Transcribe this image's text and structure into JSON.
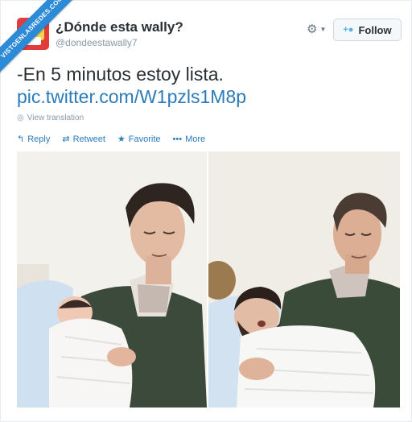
{
  "watermark": {
    "text": "VISTOENLASREDES.COM"
  },
  "profile": {
    "name": "¿Dónde esta wally?",
    "handle": "@dondeestawally7"
  },
  "header": {
    "follow_label": "Follow",
    "gear_icon": "gear-icon"
  },
  "tweet": {
    "text": "-En 5 minutos estoy lista.",
    "link": "pic.twitter.com/W1pzls1M8p",
    "translate_label": "View translation"
  },
  "actions": [
    {
      "label": "Reply",
      "icon": "reply-icon"
    },
    {
      "label": "Retweet",
      "icon": "retweet-icon"
    },
    {
      "label": "Favorite",
      "icon": "star-icon"
    },
    {
      "label": "More",
      "icon": "more-icon"
    }
  ],
  "colors": {
    "link": "#2b7bb9",
    "text": "#292f33",
    "muted": "#8899a6",
    "ribbon": "#2d8ad6"
  }
}
